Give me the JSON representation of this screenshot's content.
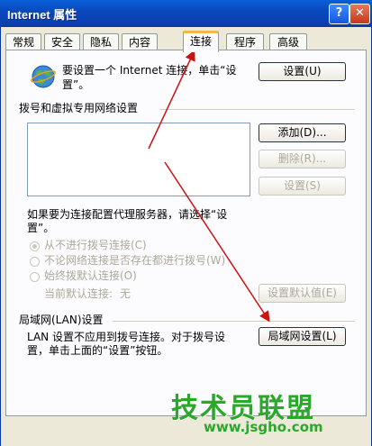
{
  "window": {
    "title": "Internet 属性",
    "help_label": "?",
    "close_label": "✕"
  },
  "tabs": [
    "常规",
    "安全",
    "隐私",
    "内容",
    "连接",
    "程序",
    "高级"
  ],
  "active_tab": "连接",
  "setup": {
    "text_line1": "要设置一个 Internet 连接，单击“设",
    "text_line2": "置”。",
    "button": "设置(U)",
    "icon": "globe-icon"
  },
  "dialup": {
    "group_label": "拨号和虚拟专用网络设置",
    "add_button": "添加(D)...",
    "remove_button": "删除(R)...",
    "settings_button": "设置(S)",
    "proxy_line1": "如果要为连接配置代理服务器，请选择“设",
    "proxy_line2": "置”。",
    "option_never": "从不进行拨号连接(C)",
    "option_no_network": "不论网络连接是否存在都进行拨号(W)",
    "option_always": "始终拨默认连接(O)",
    "current_default_label": "当前默认连接:",
    "current_default_value": "无",
    "set_default_button": "设置默认值(E)"
  },
  "lan": {
    "group_label": "局域网(LAN)设置",
    "text_line1": "LAN 设置不应用到拨号连接。对于拨号设",
    "text_line2": "置，单击上面的“设置”按钮。",
    "button": "局域网设置(L)"
  },
  "watermark": {
    "brand": "技术员联盟",
    "url": "www.jsgho.com"
  },
  "colors": {
    "annotation_arrow": "#cc1111",
    "title_bar": "#0a48c0",
    "watermark": "#2aa82a"
  }
}
